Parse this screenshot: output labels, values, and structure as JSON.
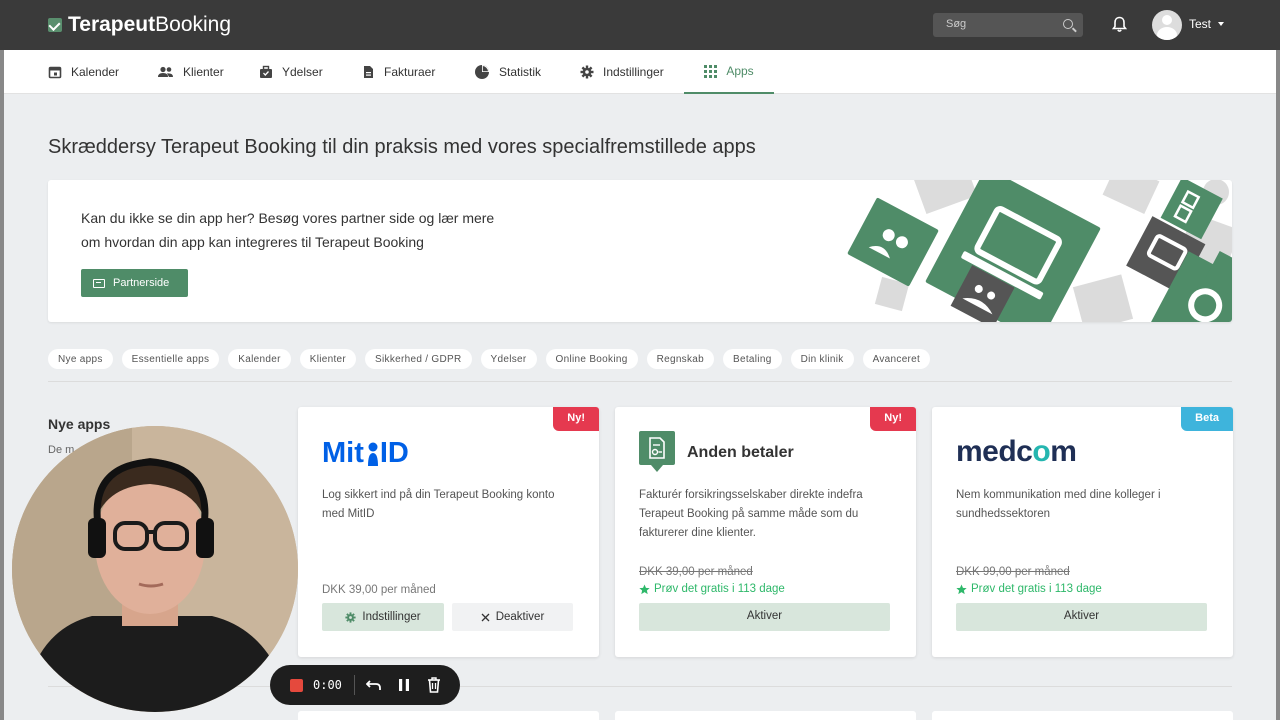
{
  "header": {
    "brand_bold": "Terapeut",
    "brand_light": "Booking",
    "search_placeholder": "Søg",
    "user_name": "Test"
  },
  "nav": {
    "items": [
      {
        "label": "Kalender",
        "icon": "calendar-icon"
      },
      {
        "label": "Klienter",
        "icon": "people-icon"
      },
      {
        "label": "Ydelser",
        "icon": "briefcase-icon"
      },
      {
        "label": "Fakturaer",
        "icon": "document-icon"
      },
      {
        "label": "Statistik",
        "icon": "pie-chart-icon"
      },
      {
        "label": "Indstillinger",
        "icon": "gear-icon"
      },
      {
        "label": "Apps",
        "icon": "grid-icon"
      }
    ],
    "active": "Apps"
  },
  "page": {
    "title": "Skræddersy Terapeut Booking til din praksis med vores specialfremstillede apps"
  },
  "partner": {
    "text": "Kan du ikke se din app her? Besøg vores partner side og lær mere om hvordan din app kan integreres til Terapeut Booking",
    "button_label": "Partnerside"
  },
  "filters": [
    "Nye apps",
    "Essentielle apps",
    "Kalender",
    "Klienter",
    "Sikkerhed / GDPR",
    "Ydelser",
    "Online Booking",
    "Regnskab",
    "Betaling",
    "Din klinik",
    "Avanceret"
  ],
  "section": {
    "title": "Nye apps",
    "subtitle": "De m"
  },
  "apps": [
    {
      "logo_text_a": "Mit",
      "logo_text_b": "ID",
      "badge": "Ny!",
      "description": "Log sikkert ind på din Terapeut Booking konto med MitID",
      "price": "DKK 39,00 per måned",
      "settings_label": "Indstillinger",
      "deactivate_label": "Deaktiver"
    },
    {
      "name": "Anden betaler",
      "badge": "Ny!",
      "description": "Fakturér forsikringsselskaber direkte indefra Terapeut Booking på samme måde som du fakturerer dine klienter.",
      "price": "DKK 39,00 per måned",
      "trial": "Prøv det gratis i 113 dage",
      "activate_label": "Aktiver"
    },
    {
      "logo_text_a": "medc",
      "logo_text_o": "o",
      "logo_text_b": "m",
      "badge": "Beta",
      "description": "Nem kommunikation med dine kolleger i sundhedssektoren",
      "price": "DKK 99,00 per måned",
      "trial": "Prøv det gratis i 113 dage",
      "activate_label": "Aktiver"
    }
  ],
  "recorder": {
    "time": "0:00"
  },
  "colors": {
    "brand_green": "#4f8c68",
    "new_badge": "#e5394f",
    "beta_badge": "#3eb4dc",
    "trial_green": "#2eb86a",
    "mitid_blue": "#0060e6",
    "medcom_navy": "#1f2f55",
    "medcom_teal": "#25b6b0"
  }
}
